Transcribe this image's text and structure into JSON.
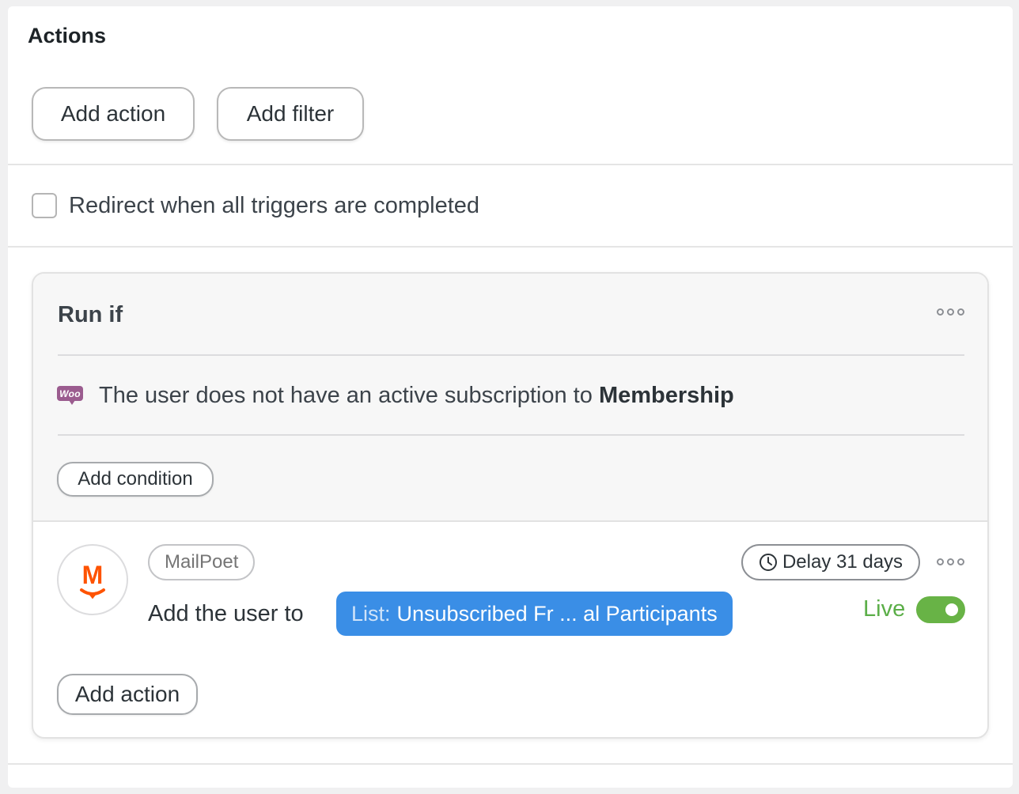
{
  "actions": {
    "title": "Actions",
    "add_action_label": "Add action",
    "add_filter_label": "Add filter"
  },
  "redirect": {
    "label": "Redirect when all triggers are completed",
    "checked": false
  },
  "run_if": {
    "title": "Run if",
    "condition_icon": "woo-icon",
    "condition_icon_text": "Woo",
    "condition_prefix": "The user does not have an active subscription to ",
    "condition_value": "Membership",
    "add_condition_label": "Add condition"
  },
  "action_item": {
    "integration_logo": "mailpoet-logo",
    "integration_tag": "MailPoet",
    "delay_label": "Delay 31 days",
    "text": "Add the user to",
    "list_prefix": "List:",
    "list_name": "Unsubscribed Fr ... al Participants",
    "status_label": "Live",
    "status_on": true,
    "add_action_label": "Add action"
  },
  "colors": {
    "accent_blue": "#3a8ee6",
    "live_green": "#68b346",
    "woo_purple": "#9b5c8f",
    "mailpoet_orange": "#fe5301"
  }
}
